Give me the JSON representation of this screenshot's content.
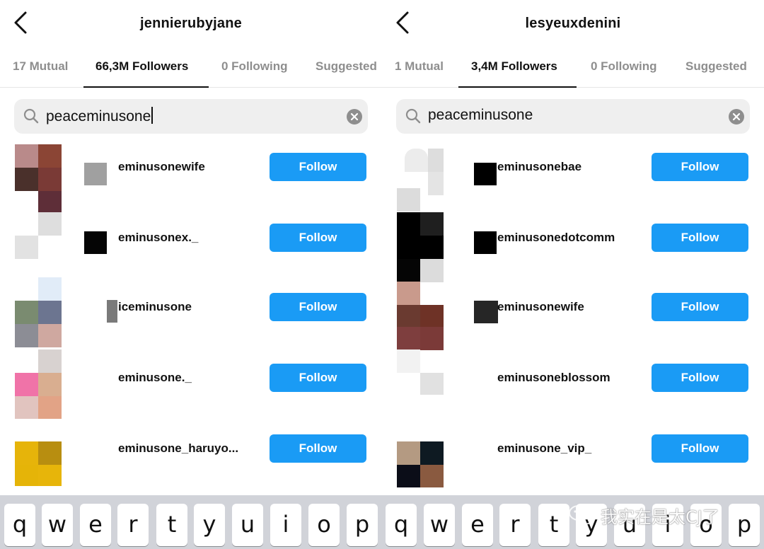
{
  "left": {
    "title": "jennierubyjane",
    "tabs": [
      "17 Mutual",
      "66,3M Followers",
      "0 Following",
      "Suggested"
    ],
    "active_tab": 1,
    "search_value": "peaceminusone",
    "rows": [
      {
        "username": "eminusonewife",
        "follow": "Follow"
      },
      {
        "username": "eminusonex._",
        "follow": "Follow"
      },
      {
        "username": "iceminusone",
        "follow": "Follow"
      },
      {
        "username": "eminusone._",
        "follow": "Follow"
      },
      {
        "username": "eminusone_haruyo...",
        "follow": "Follow"
      }
    ]
  },
  "right": {
    "title": "lesyeuxdenini",
    "tabs": [
      "1 Mutual",
      "3,4M Followers",
      "0 Following",
      "Suggested"
    ],
    "active_tab": 1,
    "search_value": "peaceminusone",
    "rows": [
      {
        "username": "eminusonebae",
        "follow": "Follow"
      },
      {
        "username": "eminusonedotcomm",
        "follow": "Follow"
      },
      {
        "username": "eminusonewife",
        "follow": "Follow"
      },
      {
        "username": "eminusoneblossom",
        "follow": "Follow"
      },
      {
        "username": "eminusone_vip_",
        "follow": "Follow"
      }
    ]
  },
  "keyboard": {
    "keys": [
      "q",
      "w",
      "e",
      "r",
      "t",
      "y",
      "u",
      "i",
      "o",
      "p",
      "q",
      "w",
      "e",
      "r",
      "t",
      "y",
      "u",
      "i",
      "o",
      "p"
    ]
  },
  "watermark": {
    "text": "我实在是太CJ了",
    "icon": "wechat-icon"
  },
  "colors": {
    "follow_button": "#1a9bf5",
    "search_bg": "#efefef",
    "keyboard_bg": "#d1d3d9"
  }
}
